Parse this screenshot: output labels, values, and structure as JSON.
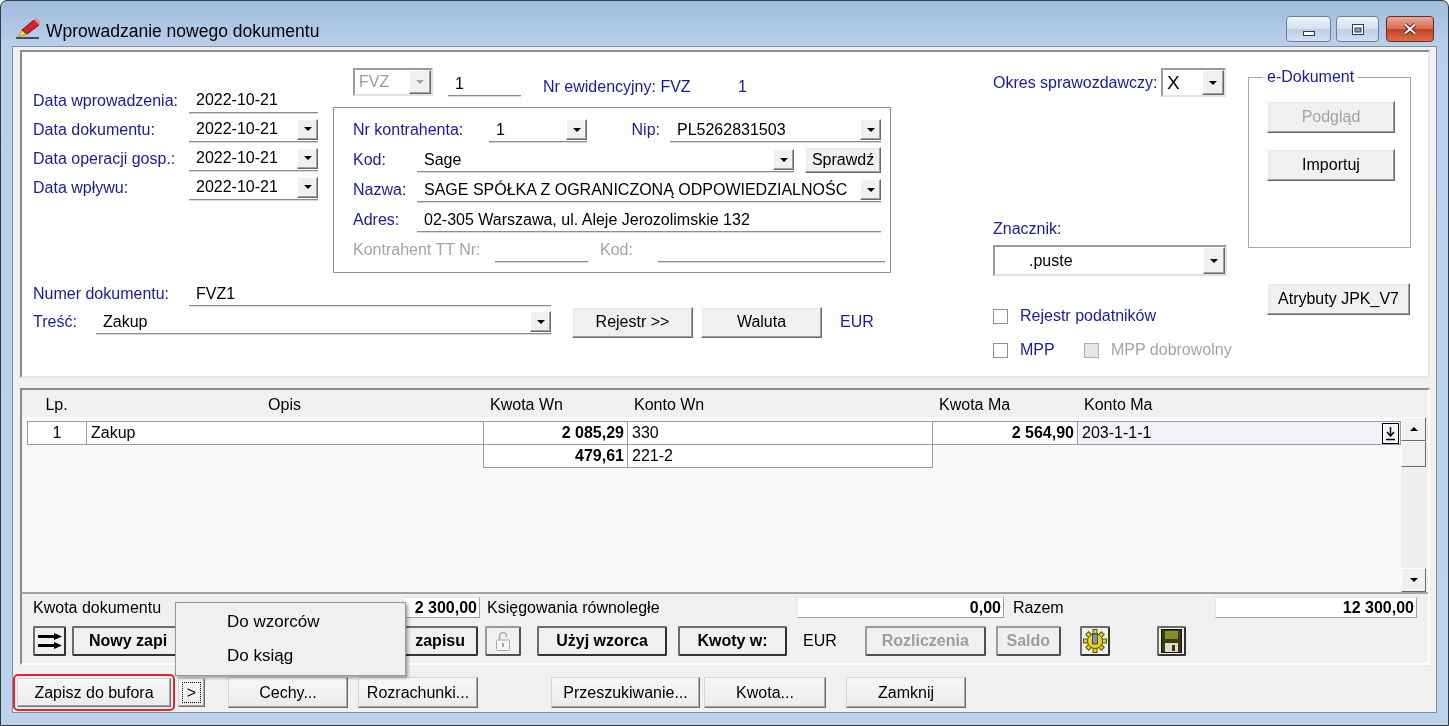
{
  "window": {
    "title": "Wprowadzanie nowego dokumentu"
  },
  "dates": [
    {
      "label": "Data wprowadzenia:",
      "field": {
        "kind": "text",
        "value": "2022-10-21"
      }
    },
    {
      "label": "Data dokumentu:",
      "field": {
        "kind": "combo",
        "value": "2022-10-21"
      }
    },
    {
      "label": "Data operacji gosp.:",
      "field": {
        "kind": "combo",
        "value": "2022-10-21"
      }
    },
    {
      "label": "Data wpływu:",
      "field": {
        "kind": "combo",
        "value": "2022-10-21"
      }
    }
  ],
  "register": {
    "type": {
      "kind": "select",
      "value": "FVZ",
      "disabled": true
    },
    "number": {
      "kind": "text",
      "value": "1"
    },
    "evidence_label": "Nr ewidencyjny: FVZ",
    "evidence_number": "1"
  },
  "contractor": {
    "number": {
      "label": "Nr kontrahenta:",
      "disabled": false,
      "field": {
        "kind": "combo",
        "value": "1"
      }
    },
    "nip": {
      "label": "Nip:",
      "disabled": false,
      "field": {
        "kind": "combo",
        "value": "PL5262831503"
      }
    },
    "code": {
      "label": "Kod:",
      "disabled": false,
      "field": {
        "kind": "combo",
        "value": "Sage"
      }
    },
    "check_button": {
      "label": "Sprawdź",
      "disabled": false
    },
    "name": {
      "label": "Nazwa:",
      "disabled": false,
      "field": {
        "kind": "combo",
        "value": "SAGE SPÓŁKA Z OGRANICZONĄ ODPOWIEDZIALNOŚC"
      }
    },
    "address": {
      "label": "Adres:",
      "disabled": false,
      "field": {
        "kind": "text",
        "value": "02-305 Warszawa, ul. Aleje Jerozolimskie 132"
      }
    },
    "tt_number": {
      "label": "Kontrahent TT Nr:",
      "disabled": true,
      "field": {
        "kind": "text"
      }
    },
    "tt_code": {
      "label": "Kod:",
      "disabled": true,
      "field": {
        "kind": "text"
      }
    }
  },
  "document": {
    "number": {
      "label": "Numer dokumentu:",
      "field": {
        "kind": "text",
        "value": "FVZ1"
      }
    },
    "content": {
      "label": "Treść:",
      "field": {
        "kind": "combo",
        "value": "Zakup"
      }
    },
    "buttons": [
      {
        "label": "Rejestr >>",
        "disabled": false
      },
      {
        "label": "Waluta",
        "disabled": false
      }
    ],
    "currency": "EUR"
  },
  "reporting": {
    "period": {
      "label": "Okres sprawozdawczy:",
      "field": {
        "kind": "select",
        "value": "X"
      }
    },
    "marker": {
      "label": "Znacznik:",
      "field": {
        "kind": "select",
        "value": ".puste"
      }
    },
    "checkbox_rows": [
      {
        "checkboxes": [
          {
            "label": "Rejestr podatników",
            "checked": false,
            "disabled": false
          }
        ]
      },
      {
        "checkboxes": [
          {
            "label": "MPP",
            "checked": false,
            "disabled": false
          },
          {
            "label": "MPP dobrowolny",
            "checked": false,
            "disabled": true
          }
        ]
      }
    ]
  },
  "e_document": {
    "title": "e-Dokument",
    "buttons": [
      {
        "label": "Podgląd",
        "disabled": true
      },
      {
        "label": "Importuj",
        "disabled": false
      }
    ]
  },
  "jpk_button": {
    "label": "Atrybuty JPK_V7",
    "disabled": false
  },
  "table": {
    "columns": [
      "Lp.",
      "Opis",
      "Kwota Wn",
      "Konto Wn",
      "Kwota Ma",
      "Konto Ma"
    ],
    "entries": [
      {
        "lp": "1",
        "description": "Zakup",
        "debit": [
          {
            "amount": "2 085,29",
            "account": "330",
            "selected": false
          },
          {
            "amount": "479,61",
            "account": "221-2",
            "selected": false
          }
        ],
        "credit": [
          {
            "amount": "2 564,90",
            "account": "203-1-1-1",
            "selected": true
          }
        ]
      }
    ]
  },
  "totals": [
    {
      "label": "Kwota dokumentu",
      "value": "2 300,00"
    },
    {
      "label": "Księgowania równoległe",
      "value": "0,00"
    },
    {
      "label": "Razem",
      "value": "12 300,00"
    }
  ],
  "tools": [
    {
      "kind": "arrows",
      "disabled": false
    },
    {
      "kind": "text",
      "label": "Nowy zapi",
      "disabled": false
    },
    {
      "kind": "text",
      "label": "zapisu",
      "disabled": false
    },
    {
      "kind": "lock",
      "disabled": true
    },
    {
      "kind": "text",
      "label": "Użyj wzorca",
      "disabled": false
    },
    {
      "kind": "text",
      "label": "Kwoty w:",
      "disabled": false
    },
    {
      "kind": "label",
      "label": "EUR"
    },
    {
      "kind": "text",
      "label": "Rozliczenia",
      "disabled": true
    },
    {
      "kind": "text",
      "label": "Saldo",
      "disabled": true
    },
    {
      "kind": "gear",
      "disabled": false
    },
    {
      "kind": "disk",
      "disabled": false
    }
  ],
  "popup_menu": {
    "items": [
      {
        "label": "Do wzorców"
      },
      {
        "label": "Do ksiąg"
      }
    ]
  },
  "bottom_buttons": [
    {
      "label": "Zapisz do bufora",
      "highlighted": true,
      "focused": false
    },
    {
      "label": ">",
      "highlighted": false,
      "focused": true
    },
    {
      "label": "Cechy...",
      "highlighted": false,
      "focused": false
    },
    {
      "label": "Rozrachunki...",
      "highlighted": false,
      "focused": false
    },
    {
      "label": "Przeszukiwanie...",
      "highlighted": false,
      "focused": false
    },
    {
      "label": "Kwota...",
      "highlighted": false,
      "focused": false
    },
    {
      "label": "Zamknij",
      "highlighted": false,
      "focused": false
    }
  ]
}
